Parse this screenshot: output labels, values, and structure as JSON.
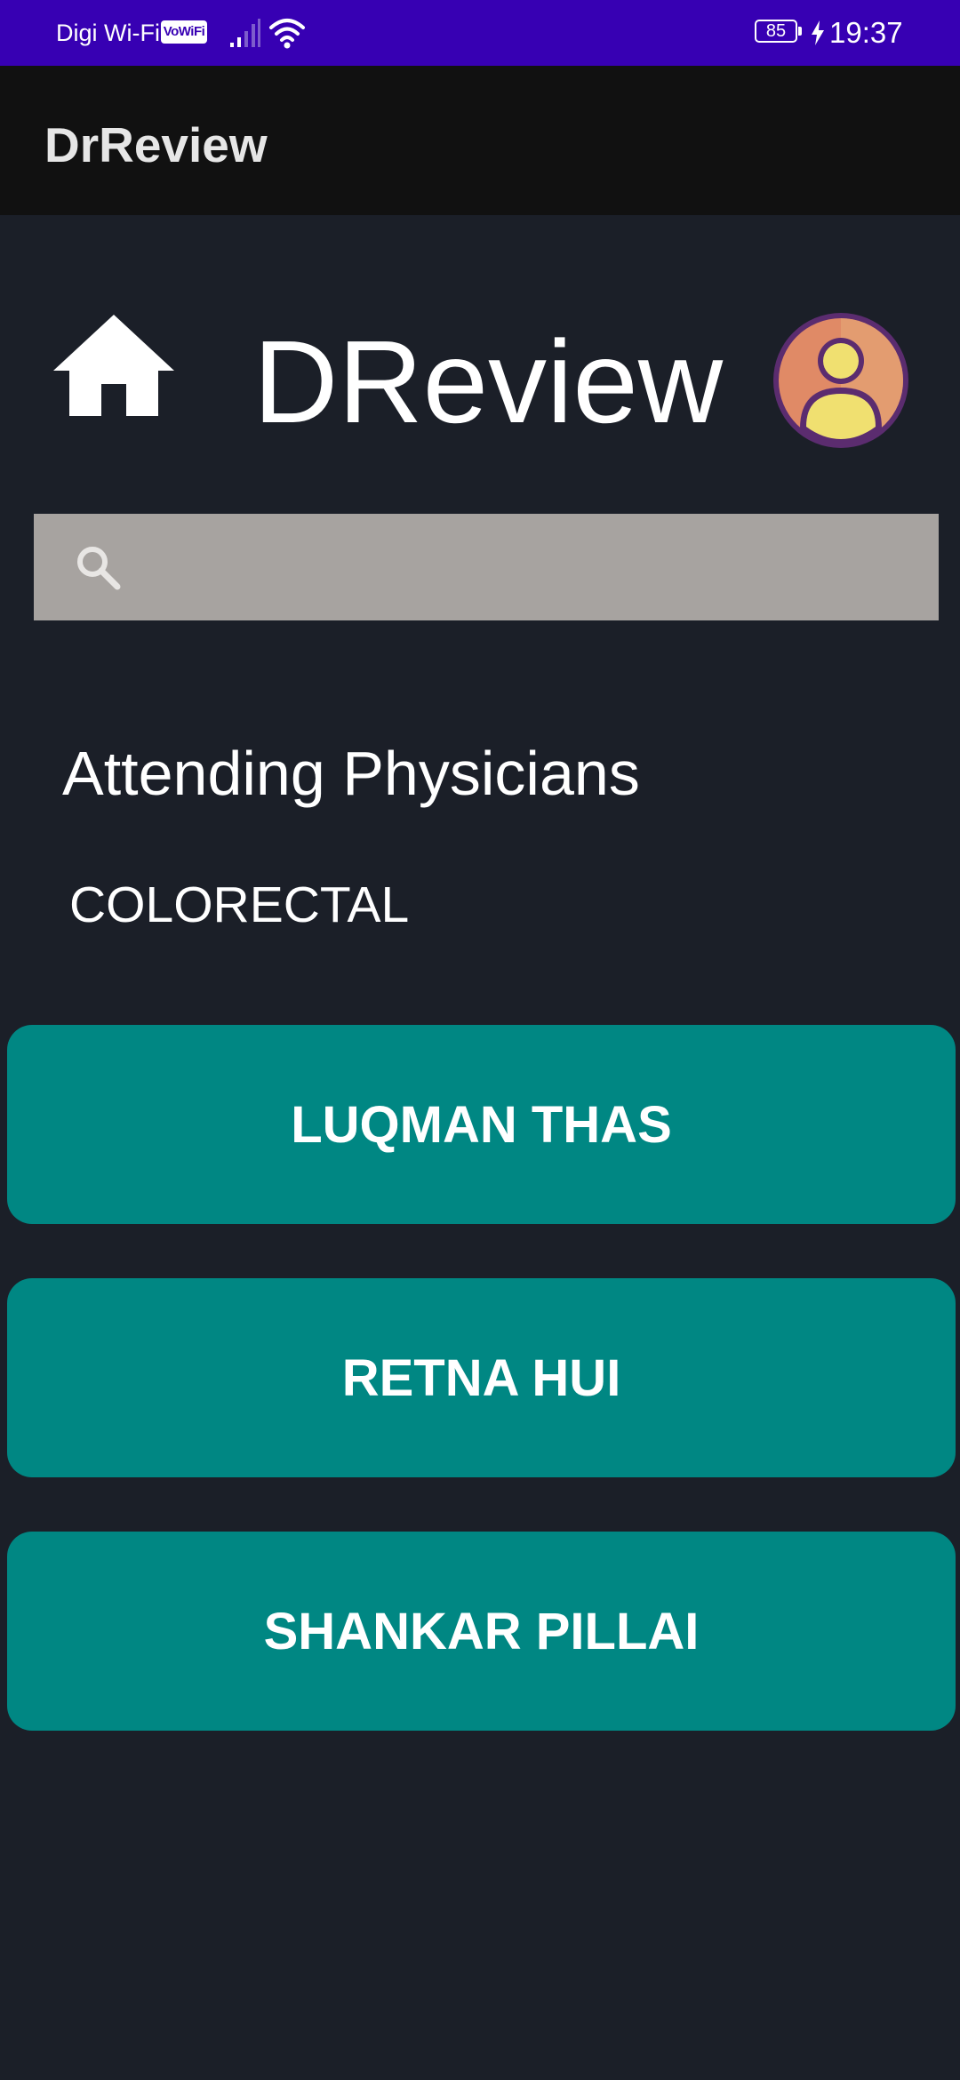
{
  "status_bar": {
    "carrier": "Digi Wi-Fi",
    "vowifi_badge": "VoWiFi",
    "battery_level": "85",
    "time": "19:37",
    "colors": {
      "background": "#3700b3"
    },
    "icons": [
      "signal-icon",
      "wifi-icon",
      "battery-icon",
      "charging-icon"
    ]
  },
  "app_bar": {
    "title": "DrReview"
  },
  "header": {
    "home_icon": "home-icon",
    "brand_title": "DReview",
    "avatar_icon": "user-avatar-icon"
  },
  "search": {
    "icon": "search-icon",
    "value": "",
    "placeholder": ""
  },
  "main": {
    "section_title": "Attending Physicians",
    "department": "COLORECTAL",
    "physicians": [
      {
        "label": "LUQMAN THAS"
      },
      {
        "label": "RETNA HUI"
      },
      {
        "label": "SHANKAR PILLAI"
      }
    ]
  },
  "colors": {
    "background": "#1b1f28",
    "app_bar": "#111111",
    "search_bar": "#a7a3a0",
    "physician_button": "#008783",
    "avatar_ring": "#5b2c6f",
    "avatar_fill": "#e08a66",
    "avatar_person": "#f0e070"
  }
}
